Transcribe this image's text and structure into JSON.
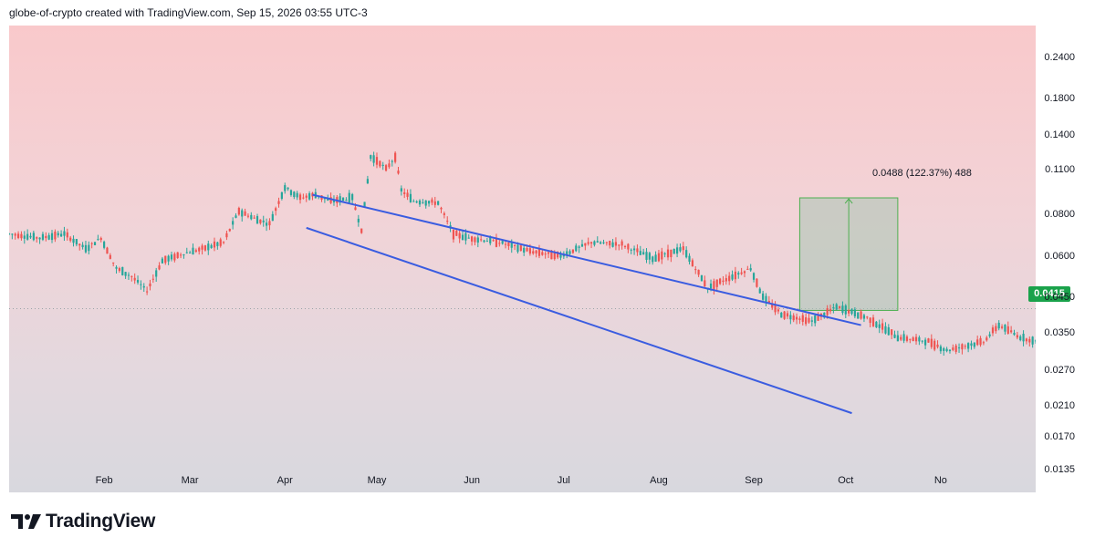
{
  "header": {
    "attribution": "globe-of-crypto created with TradingView.com, Sep 15, 2026 03:55 UTC-3"
  },
  "brand": {
    "name": "TradingView",
    "logo_icon": "tradingview-logo-icon"
  },
  "colors": {
    "up": "#26a69a",
    "down": "#ef5350",
    "trendline": "#3a5ce0",
    "price_tag": "#1aa24b",
    "measure_fill": "#a9c5b5",
    "measure_line": "#4caf50"
  },
  "current_price": "0.0415",
  "measure_label": "0.0488 (122.37%) 488",
  "chart_data": {
    "type": "candlestick",
    "y_scale": "log",
    "ylim": [
      0.0115,
      0.3
    ],
    "x_axis": {
      "ticks": [
        "Feb",
        "Mar",
        "Apr",
        "May",
        "Jun",
        "Jul",
        "Aug",
        "Sep",
        "Oct",
        "No"
      ],
      "tick_days": [
        31,
        59,
        90,
        120,
        151,
        181,
        212,
        243,
        273,
        304
      ],
      "range_days": [
        0,
        335
      ]
    },
    "y_axis": {
      "ticks": [
        "0.2400",
        "0.1800",
        "0.1400",
        "0.1100",
        "0.0800",
        "0.0600",
        "0.0450",
        "0.0350",
        "0.0270",
        "0.0210",
        "0.0170",
        "0.0135"
      ]
    },
    "price_points": [
      [
        0,
        0.07
      ],
      [
        10,
        0.068
      ],
      [
        18,
        0.07
      ],
      [
        25,
        0.063
      ],
      [
        30,
        0.068
      ],
      [
        35,
        0.055
      ],
      [
        40,
        0.052
      ],
      [
        45,
        0.047
      ],
      [
        50,
        0.058
      ],
      [
        57,
        0.061
      ],
      [
        63,
        0.063
      ],
      [
        70,
        0.066
      ],
      [
        75,
        0.082
      ],
      [
        80,
        0.078
      ],
      [
        85,
        0.075
      ],
      [
        90,
        0.097
      ],
      [
        95,
        0.09
      ],
      [
        100,
        0.092
      ],
      [
        105,
        0.088
      ],
      [
        112,
        0.09
      ],
      [
        115,
        0.072
      ],
      [
        118,
        0.12
      ],
      [
        121,
        0.115
      ],
      [
        123,
        0.11
      ],
      [
        126,
        0.12
      ],
      [
        128,
        0.095
      ],
      [
        132,
        0.088
      ],
      [
        140,
        0.087
      ],
      [
        145,
        0.07
      ],
      [
        150,
        0.068
      ],
      [
        160,
        0.066
      ],
      [
        170,
        0.062
      ],
      [
        180,
        0.06
      ],
      [
        190,
        0.066
      ],
      [
        200,
        0.065
      ],
      [
        210,
        0.059
      ],
      [
        220,
        0.063
      ],
      [
        228,
        0.048
      ],
      [
        236,
        0.052
      ],
      [
        242,
        0.055
      ],
      [
        246,
        0.045
      ],
      [
        252,
        0.04
      ],
      [
        262,
        0.038
      ],
      [
        270,
        0.042
      ],
      [
        280,
        0.039
      ],
      [
        290,
        0.034
      ],
      [
        300,
        0.033
      ],
      [
        306,
        0.031
      ],
      [
        312,
        0.032
      ],
      [
        318,
        0.033
      ],
      [
        323,
        0.037
      ],
      [
        330,
        0.034
      ],
      [
        335,
        0.033
      ]
    ],
    "trendlines": [
      {
        "name": "upper",
        "points": [
          [
            99,
            0.092
          ],
          [
            278,
            0.037
          ]
        ]
      },
      {
        "name": "lower",
        "points": [
          [
            97,
            0.073
          ],
          [
            275,
            0.02
          ]
        ]
      }
    ],
    "measure": {
      "x0": 258,
      "x1": 290,
      "y0": 0.041,
      "y1": 0.09
    }
  }
}
